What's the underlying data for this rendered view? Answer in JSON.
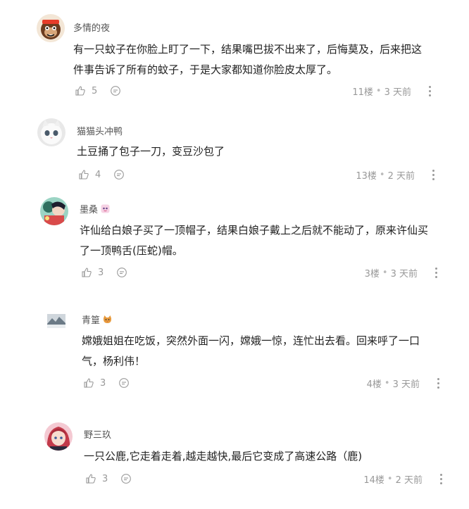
{
  "comments": [
    {
      "username": "多情的夜",
      "text": "有一只蚊子在你脸上盯了一下，结果嘴巴拔不出来了，后悔莫及，后来把这件事告诉了所有的蚊子，于是大家都知道你脸皮太厚了。",
      "likes": "5",
      "floor": "11楼",
      "time": "3 天前",
      "avatar": "cartoon-monkey-avatar",
      "badge": ""
    },
    {
      "username": "猫猫头冲鸭",
      "text": "土豆捅了包子一刀，变豆沙包了",
      "likes": "4",
      "floor": "13楼",
      "time": "2 天前",
      "avatar": "white-cat-avatar",
      "badge": ""
    },
    {
      "username": "墨桑",
      "text": "许仙给白娘子买了一顶帽子，结果白娘子戴上之后就不能动了，原来许仙买了一顶鸭舌(压蛇)帽。",
      "likes": "3",
      "floor": "3楼",
      "time": "3 天前",
      "avatar": "anime-character-avatar",
      "badge": "anime-sticker-badge"
    },
    {
      "username": "青篁",
      "text": "嫦娥姐姐在吃饭，突然外面一闪，嫦娥一惊，连忙出去看。回来呼了一口气，杨利伟！",
      "likes": "3",
      "floor": "4楼",
      "time": "3 天前",
      "avatar": "landscape-avatar",
      "badge": "cat-emoji-badge"
    },
    {
      "username": "野三玖",
      "text": "一只公鹿,它走着走着,越走越快,最后它变成了高速公路（鹿)",
      "likes": "3",
      "floor": "14楼",
      "time": "2 天前",
      "avatar": "red-hair-anime-avatar",
      "badge": ""
    }
  ],
  "separator": "•",
  "icons": {
    "like": "thumbs-up-icon",
    "reply": "reply-bubble-icon",
    "more": "more-vertical-icon"
  },
  "colors": {
    "text": "#222222",
    "meta": "#999999",
    "username": "#555555"
  }
}
